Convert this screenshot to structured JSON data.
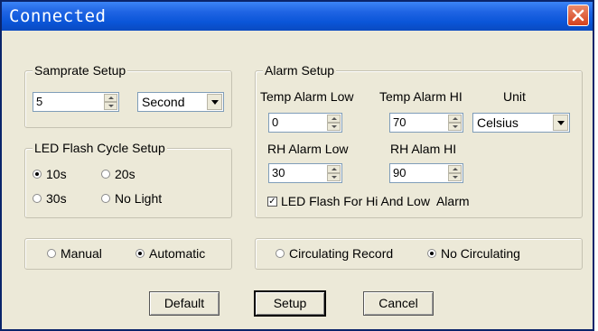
{
  "window": {
    "title": "Connected",
    "close_icon": "close-icon"
  },
  "samprate": {
    "legend": "Samprate Setup",
    "value": "5",
    "unit": "Second"
  },
  "led": {
    "legend": "LED Flash Cycle Setup",
    "options": [
      {
        "label": "10s",
        "selected": true
      },
      {
        "label": "20s",
        "selected": false
      },
      {
        "label": "30s",
        "selected": false
      },
      {
        "label": "No Light",
        "selected": false
      }
    ]
  },
  "alarm": {
    "legend": "Alarm Setup",
    "temp_low_label": "Temp Alarm Low",
    "temp_low_value": "0",
    "temp_hi_label": "Temp Alarm HI",
    "temp_hi_value": "70",
    "unit_label": "Unit",
    "unit_value": "Celsius",
    "rh_low_label": "RH Alarm Low",
    "rh_low_value": "30",
    "rh_hi_label": "RH Alam HI",
    "rh_hi_value": "90",
    "led_flash_label": "LED Flash For Hi And Low  Alarm",
    "led_flash_checked": true
  },
  "mode": {
    "manual_label": "Manual",
    "automatic_label": "Automatic",
    "selected": "Automatic"
  },
  "record": {
    "circulating_label": "Circulating Record",
    "no_circulating_label": "No Circulating",
    "selected": "No Circulating"
  },
  "buttons": {
    "default": "Default",
    "setup": "Setup",
    "cancel": "Cancel"
  }
}
